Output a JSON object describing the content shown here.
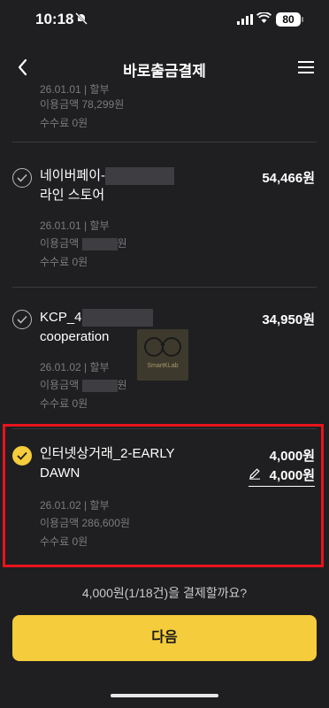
{
  "status": {
    "time": "10:18",
    "battery": "80"
  },
  "nav": {
    "title": "바로출금결제"
  },
  "items": [
    {
      "date_partial": "26.01.01 | 할부",
      "usage": "이용금액 78,299원",
      "fee": "수수료 0원"
    },
    {
      "merchant_line1": "네이버페이-",
      "merchant_line2": "라인 스토어",
      "amount": "54,466원",
      "date": "26.01.01 | 할부",
      "usage_label": "이용금액",
      "usage_suffix": "원",
      "fee": "수수료 0원"
    },
    {
      "merchant_line1": "KCP_4",
      "merchant_line2": "cooperation",
      "amount": "34,950원",
      "date": "26.01.02 | 할부",
      "usage_label": "이용금액",
      "usage_suffix": "원",
      "fee": "수수료 0원"
    },
    {
      "merchant_line1": "인터넷상거래_2-EARLY",
      "merchant_line2": "DAWN",
      "amount": "4,000원",
      "edit_amount": "4,000원",
      "date": "26.01.02 | 할부",
      "usage": "이용금액 286,600원",
      "fee": "수수료 0원",
      "selected": true
    }
  ],
  "watermark": "SmartKLab",
  "question": "4,000원(1/18건)을 결제할까요?",
  "next_button": "다음",
  "colors": {
    "accent": "#f4cc3c",
    "background": "#1f1f21",
    "highlight": "#e8141c"
  }
}
